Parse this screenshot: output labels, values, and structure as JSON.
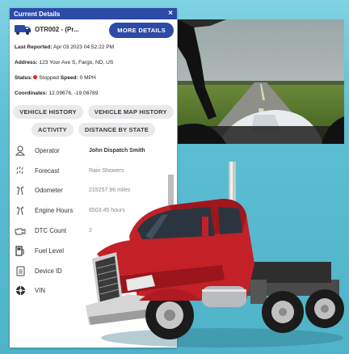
{
  "panel": {
    "title": "Current Details",
    "close_glyph": "×",
    "vehicle_name": "OTR002 - (Pr...",
    "more_details": "MORE DETAILS",
    "last_reported_label": "Last Reported:",
    "last_reported": "Apr 03 2023 04:52:22 PM",
    "address_label": "Address:",
    "address": "123 Your Ave S, Fargo, ND, US",
    "status_label": "Status:",
    "status": "Stopped",
    "speed_label": "Speed:",
    "speed": "0 MPH",
    "coordinates_label": "Coordinates:",
    "coordinates": "12.09676, -19.06789"
  },
  "chips": [
    "VEHICLE HISTORY",
    "VEHICLE MAP HISTORY",
    "ACTIVITY",
    "DISTANCE BY STATE"
  ],
  "details": [
    {
      "label": "Operator",
      "value": "John Dispatch Smith",
      "icon": "person-icon"
    },
    {
      "label": "Forecast",
      "value": "Rain Showers",
      "icon": "rain-icon"
    },
    {
      "label": "Odometer",
      "value": "215257.96 miles",
      "icon": "road-icon"
    },
    {
      "label": "Engine Hours",
      "value": "6503.45 hours",
      "icon": "road-icon"
    },
    {
      "label": "DTC Count",
      "value": "2",
      "icon": "engine-icon"
    },
    {
      "label": "Fuel Level",
      "value": "",
      "icon": "fuel-icon"
    },
    {
      "label": "Device ID",
      "value": "",
      "icon": "device-icon"
    },
    {
      "label": "VIN",
      "value": "",
      "icon": "vin-icon"
    }
  ],
  "colors": {
    "accent": "#2c4aa6",
    "status_stopped": "#e0261c",
    "truck_cab": "#c42028"
  }
}
